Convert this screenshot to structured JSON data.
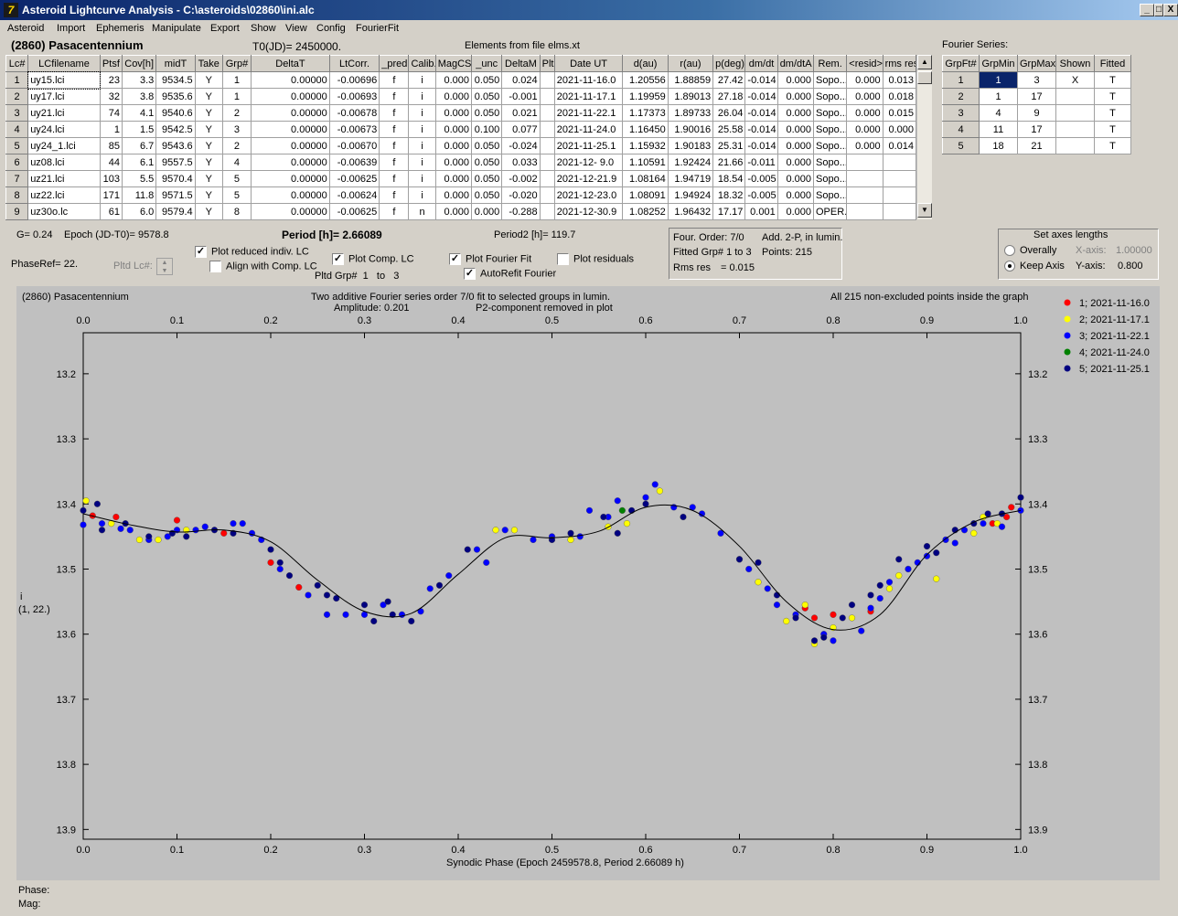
{
  "window": {
    "title": "Asteroid Lightcurve Analysis - C:\\asteroids\\02860\\ini.alc",
    "app_icon": "7",
    "buttons": [
      "_",
      "□",
      "X"
    ]
  },
  "menu": [
    "Asteroid",
    "Import",
    "Ephemeris",
    "Manipulate",
    "Export",
    "Show",
    "View",
    "Config",
    "FourierFit"
  ],
  "asteroid_name": "(2860) Pasacentennium",
  "t0": "T0(JD)= 2450000.",
  "elements": "Elements from file elms.xt",
  "lc_table": {
    "headers": [
      "Lc#",
      "LCfilename",
      "Ptsf",
      "Cov[h]",
      "midT",
      "Take",
      "Grp#",
      "DeltaT",
      "LtCorr.",
      "_pred.",
      "Calib.",
      "MagCS",
      "_unc",
      "DeltaM",
      "Plt",
      "Date UT",
      "d(au)",
      "r(au)",
      "p(deg)",
      "dm/dt",
      "dm/dtA",
      "Rem.",
      "<resid>",
      "rms res"
    ],
    "rows": [
      [
        "1",
        "uy15.lci",
        "23",
        "3.3",
        "9534.5",
        "Y",
        "1",
        "0.00000",
        "-0.00696",
        "f",
        "i",
        "0.000",
        "0.050",
        "0.024",
        "",
        "2021-11-16.0",
        "1.20556",
        "1.88859",
        "27.42",
        "-0.014",
        "0.000",
        "Sopo...",
        "0.000",
        "0.013"
      ],
      [
        "2",
        "uy17.lci",
        "32",
        "3.8",
        "9535.6",
        "Y",
        "1",
        "0.00000",
        "-0.00693",
        "f",
        "i",
        "0.000",
        "0.050",
        "-0.001",
        "",
        "2021-11-17.1",
        "1.19959",
        "1.89013",
        "27.18",
        "-0.014",
        "0.000",
        "Sopo...",
        "0.000",
        "0.018"
      ],
      [
        "3",
        "uy21.lci",
        "74",
        "4.1",
        "9540.6",
        "Y",
        "2",
        "0.00000",
        "-0.00678",
        "f",
        "i",
        "0.000",
        "0.050",
        "0.021",
        "",
        "2021-11-22.1",
        "1.17373",
        "1.89733",
        "26.04",
        "-0.014",
        "0.000",
        "Sopo...",
        "0.000",
        "0.015"
      ],
      [
        "4",
        "uy24.lci",
        "1",
        "1.5",
        "9542.5",
        "Y",
        "3",
        "0.00000",
        "-0.00673",
        "f",
        "i",
        "0.000",
        "0.100",
        "0.077",
        "",
        "2021-11-24.0",
        "1.16450",
        "1.90016",
        "25.58",
        "-0.014",
        "0.000",
        "Sopo...",
        "0.000",
        "0.000"
      ],
      [
        "5",
        "uy24_1.lci",
        "85",
        "6.7",
        "9543.6",
        "Y",
        "2",
        "0.00000",
        "-0.00670",
        "f",
        "i",
        "0.000",
        "0.050",
        "-0.024",
        "",
        "2021-11-25.1",
        "1.15932",
        "1.90183",
        "25.31",
        "-0.014",
        "0.000",
        "Sopo...",
        "0.000",
        "0.014"
      ],
      [
        "6",
        "uz08.lci",
        "44",
        "6.1",
        "9557.5",
        "Y",
        "4",
        "0.00000",
        "-0.00639",
        "f",
        "i",
        "0.000",
        "0.050",
        "0.033",
        "",
        "2021-12- 9.0",
        "1.10591",
        "1.92424",
        "21.66",
        "-0.011",
        "0.000",
        "Sopo...",
        "",
        ""
      ],
      [
        "7",
        "uz21.lci",
        "103",
        "5.5",
        "9570.4",
        "Y",
        "5",
        "0.00000",
        "-0.00625",
        "f",
        "i",
        "0.000",
        "0.050",
        "-0.002",
        "",
        "2021-12-21.9",
        "1.08164",
        "1.94719",
        "18.54",
        "-0.005",
        "0.000",
        "Sopo...",
        "",
        ""
      ],
      [
        "8",
        "uz22.lci",
        "171",
        "11.8",
        "9571.5",
        "Y",
        "5",
        "0.00000",
        "-0.00624",
        "f",
        "i",
        "0.000",
        "0.050",
        "-0.020",
        "",
        "2021-12-23.0",
        "1.08091",
        "1.94924",
        "18.32",
        "-0.005",
        "0.000",
        "Sopo...",
        "",
        ""
      ],
      [
        "9",
        "uz30o.lc",
        "61",
        "6.0",
        "9579.4",
        "Y",
        "8",
        "0.00000",
        "-0.00625",
        "f",
        "n",
        "0.000",
        "0.000",
        "-0.288",
        "",
        "2021-12-30.9",
        "1.08252",
        "1.96432",
        "17.17",
        "0.001",
        "0.000",
        "OPER.",
        "",
        " "
      ]
    ]
  },
  "fourier": {
    "label": "Fourier Series:",
    "headers": [
      "GrpFt#",
      "GrpMin",
      "GrpMax",
      "Shown",
      "Fitted"
    ],
    "rows": [
      [
        "1",
        "1",
        "3",
        "X",
        "T"
      ],
      [
        "2",
        "1",
        "17",
        "",
        "T"
      ],
      [
        "3",
        "4",
        "9",
        "",
        "T"
      ],
      [
        "4",
        "11",
        "17",
        "",
        "T"
      ],
      [
        "5",
        "18",
        "21",
        "",
        "T"
      ]
    ]
  },
  "info": {
    "g": "G= 0.24",
    "epoch": "Epoch (JD-T0)= 9578.8",
    "period": "Period [h]= 2.66089",
    "period2": "Period2 [h]= 119.7",
    "phaseref": "PhaseRef= 22.",
    "pltd_lc": "Pltd Lc#:"
  },
  "checks": {
    "plot_reduced": "Plot reduced indiv. LC",
    "align": "Align with Comp. LC",
    "plot_comp": "Plot Comp. LC",
    "pltd_grp": "Pltd Grp#",
    "grp_from": "1",
    "grp_to_label": "to",
    "grp_to": "3",
    "plot_fourier": "Plot Fourier Fit",
    "plot_resid": "Plot residuals",
    "autorefit": "AutoRefit Fourier"
  },
  "fit_info": {
    "order": "Four. Order:  7/0",
    "add": "Add. 2-P, in lumin.",
    "fitted": "Fitted Grp# 1 to 3",
    "points": "Points: 215",
    "rms_label": "Rms res",
    "rms": "= 0.015"
  },
  "axes": {
    "title": "Set axes lengths",
    "overall": "Overally",
    "keep": "Keep Axis",
    "xaxis_label": "X-axis:",
    "xaxis": "1.00000",
    "yaxis_label": "Y-axis:",
    "yaxis": "0.800"
  },
  "plot": {
    "top_left": "(2860) Pasacentennium",
    "subtitle1": "Two additive Fourier series order 7/0 fit to selected groups in lumin.",
    "subtitle2a": "Amplitude: 0.201",
    "subtitle2b": "P2-component removed in plot",
    "top_right": "All 215 non-excluded points inside the graph",
    "ylabel1": "i",
    "ylabel2": "(1, 22.)",
    "xlabel": "Synodic Phase (Epoch 2459578.8, Period 2.66089 h)"
  },
  "status": {
    "phase": "Phase:",
    "mag": "Mag:"
  },
  "chart_data": {
    "type": "scatter",
    "x_ticks": [
      "0.0",
      "0.1",
      "0.2",
      "0.3",
      "0.4",
      "0.5",
      "0.6",
      "0.7",
      "0.8",
      "0.9",
      "1.0"
    ],
    "y_ticks": [
      "13.2",
      "13.3",
      "13.4",
      "13.5",
      "13.6",
      "13.7",
      "13.8",
      "13.9"
    ],
    "xlim": [
      0,
      1
    ],
    "ylim": [
      13.915,
      13.137
    ],
    "y_inverted": true,
    "legend": [
      {
        "name": "1; 2021-11-16.0",
        "color": "#ff0000"
      },
      {
        "name": "2; 2021-11-17.1",
        "color": "#ffff00"
      },
      {
        "name": "3; 2021-11-22.1",
        "color": "#0000ff"
      },
      {
        "name": "4; 2021-11-24.0",
        "color": "#008000"
      },
      {
        "name": "5; 2021-11-25.1",
        "color": "#000080"
      }
    ],
    "fit_curve": [
      [
        0,
        13.415
      ],
      [
        0.05,
        13.432
      ],
      [
        0.1,
        13.443
      ],
      [
        0.15,
        13.44
      ],
      [
        0.2,
        13.458
      ],
      [
        0.25,
        13.517
      ],
      [
        0.3,
        13.565
      ],
      [
        0.35,
        13.568
      ],
      [
        0.4,
        13.508
      ],
      [
        0.45,
        13.452
      ],
      [
        0.5,
        13.452
      ],
      [
        0.55,
        13.442
      ],
      [
        0.6,
        13.405
      ],
      [
        0.65,
        13.41
      ],
      [
        0.7,
        13.465
      ],
      [
        0.75,
        13.55
      ],
      [
        0.8,
        13.593
      ],
      [
        0.85,
        13.57
      ],
      [
        0.9,
        13.478
      ],
      [
        0.95,
        13.428
      ],
      [
        1.0,
        13.41
      ]
    ],
    "series": [
      {
        "name": "1",
        "color": "#ff0000",
        "points": [
          [
            0.01,
            13.418
          ],
          [
            0.035,
            13.42
          ],
          [
            0.1,
            13.425
          ],
          [
            0.15,
            13.445
          ],
          [
            0.2,
            13.49
          ],
          [
            0.23,
            13.528
          ],
          [
            0.77,
            13.56
          ],
          [
            0.78,
            13.575
          ],
          [
            0.8,
            13.57
          ],
          [
            0.84,
            13.565
          ],
          [
            0.97,
            13.43
          ],
          [
            0.985,
            13.42
          ],
          [
            0.99,
            13.405
          ]
        ]
      },
      {
        "name": "2",
        "color": "#ffff00",
        "points": [
          [
            0.003,
            13.395
          ],
          [
            0.03,
            13.43
          ],
          [
            0.06,
            13.455
          ],
          [
            0.08,
            13.455
          ],
          [
            0.11,
            13.44
          ],
          [
            0.44,
            13.44
          ],
          [
            0.46,
            13.44
          ],
          [
            0.52,
            13.455
          ],
          [
            0.56,
            13.435
          ],
          [
            0.58,
            13.43
          ],
          [
            0.615,
            13.38
          ],
          [
            0.72,
            13.52
          ],
          [
            0.75,
            13.58
          ],
          [
            0.77,
            13.555
          ],
          [
            0.78,
            13.615
          ],
          [
            0.8,
            13.59
          ],
          [
            0.82,
            13.575
          ],
          [
            0.86,
            13.53
          ],
          [
            0.87,
            13.51
          ],
          [
            0.88,
            13.5
          ],
          [
            0.91,
            13.515
          ],
          [
            0.95,
            13.445
          ],
          [
            0.96,
            13.42
          ],
          [
            0.975,
            13.43
          ]
        ]
      },
      {
        "name": "3",
        "color": "#0000ff",
        "points": [
          [
            0.0,
            13.432
          ],
          [
            0.02,
            13.43
          ],
          [
            0.04,
            13.438
          ],
          [
            0.05,
            13.44
          ],
          [
            0.07,
            13.455
          ],
          [
            0.09,
            13.45
          ],
          [
            0.1,
            13.44
          ],
          [
            0.12,
            13.44
          ],
          [
            0.13,
            13.435
          ],
          [
            0.16,
            13.43
          ],
          [
            0.17,
            13.43
          ],
          [
            0.18,
            13.445
          ],
          [
            0.19,
            13.455
          ],
          [
            0.21,
            13.5
          ],
          [
            0.24,
            13.54
          ],
          [
            0.26,
            13.57
          ],
          [
            0.28,
            13.57
          ],
          [
            0.3,
            13.57
          ],
          [
            0.32,
            13.555
          ],
          [
            0.34,
            13.57
          ],
          [
            0.36,
            13.565
          ],
          [
            0.37,
            13.53
          ],
          [
            0.39,
            13.51
          ],
          [
            0.42,
            13.47
          ],
          [
            0.43,
            13.49
          ],
          [
            0.45,
            13.44
          ],
          [
            0.48,
            13.455
          ],
          [
            0.5,
            13.45
          ],
          [
            0.53,
            13.45
          ],
          [
            0.54,
            13.41
          ],
          [
            0.56,
            13.42
          ],
          [
            0.57,
            13.395
          ],
          [
            0.6,
            13.39
          ],
          [
            0.61,
            13.37
          ],
          [
            0.63,
            13.405
          ],
          [
            0.65,
            13.405
          ],
          [
            0.66,
            13.415
          ],
          [
            0.68,
            13.445
          ],
          [
            0.7,
            13.485
          ],
          [
            0.71,
            13.5
          ],
          [
            0.73,
            13.53
          ],
          [
            0.74,
            13.555
          ],
          [
            0.76,
            13.57
          ],
          [
            0.79,
            13.6
          ],
          [
            0.8,
            13.61
          ],
          [
            0.83,
            13.595
          ],
          [
            0.84,
            13.56
          ],
          [
            0.85,
            13.545
          ],
          [
            0.86,
            13.52
          ],
          [
            0.88,
            13.5
          ],
          [
            0.89,
            13.49
          ],
          [
            0.9,
            13.48
          ],
          [
            0.92,
            13.455
          ],
          [
            0.93,
            13.46
          ],
          [
            0.94,
            13.44
          ],
          [
            0.96,
            13.43
          ],
          [
            0.98,
            13.435
          ],
          [
            1.0,
            13.41
          ]
        ]
      },
      {
        "name": "4",
        "color": "#008000",
        "points": [
          [
            0.575,
            13.41
          ]
        ]
      },
      {
        "name": "5",
        "color": "#000080",
        "points": [
          [
            0.0,
            13.41
          ],
          [
            0.015,
            13.4
          ],
          [
            0.02,
            13.44
          ],
          [
            0.045,
            13.43
          ],
          [
            0.07,
            13.45
          ],
          [
            0.095,
            13.445
          ],
          [
            0.11,
            13.45
          ],
          [
            0.14,
            13.44
          ],
          [
            0.16,
            13.445
          ],
          [
            0.2,
            13.47
          ],
          [
            0.21,
            13.49
          ],
          [
            0.22,
            13.51
          ],
          [
            0.25,
            13.525
          ],
          [
            0.26,
            13.54
          ],
          [
            0.27,
            13.545
          ],
          [
            0.3,
            13.555
          ],
          [
            0.31,
            13.58
          ],
          [
            0.325,
            13.55
          ],
          [
            0.33,
            13.57
          ],
          [
            0.35,
            13.58
          ],
          [
            0.38,
            13.525
          ],
          [
            0.41,
            13.47
          ],
          [
            0.5,
            13.455
          ],
          [
            0.52,
            13.445
          ],
          [
            0.555,
            13.42
          ],
          [
            0.57,
            13.445
          ],
          [
            0.585,
            13.41
          ],
          [
            0.6,
            13.4
          ],
          [
            0.64,
            13.42
          ],
          [
            0.7,
            13.485
          ],
          [
            0.72,
            13.49
          ],
          [
            0.74,
            13.54
          ],
          [
            0.76,
            13.575
          ],
          [
            0.78,
            13.61
          ],
          [
            0.79,
            13.605
          ],
          [
            0.81,
            13.575
          ],
          [
            0.82,
            13.555
          ],
          [
            0.84,
            13.54
          ],
          [
            0.85,
            13.525
          ],
          [
            0.87,
            13.485
          ],
          [
            0.9,
            13.465
          ],
          [
            0.91,
            13.475
          ],
          [
            0.93,
            13.44
          ],
          [
            0.95,
            13.43
          ],
          [
            0.965,
            13.415
          ],
          [
            0.98,
            13.415
          ],
          [
            1.0,
            13.39
          ]
        ]
      }
    ]
  }
}
